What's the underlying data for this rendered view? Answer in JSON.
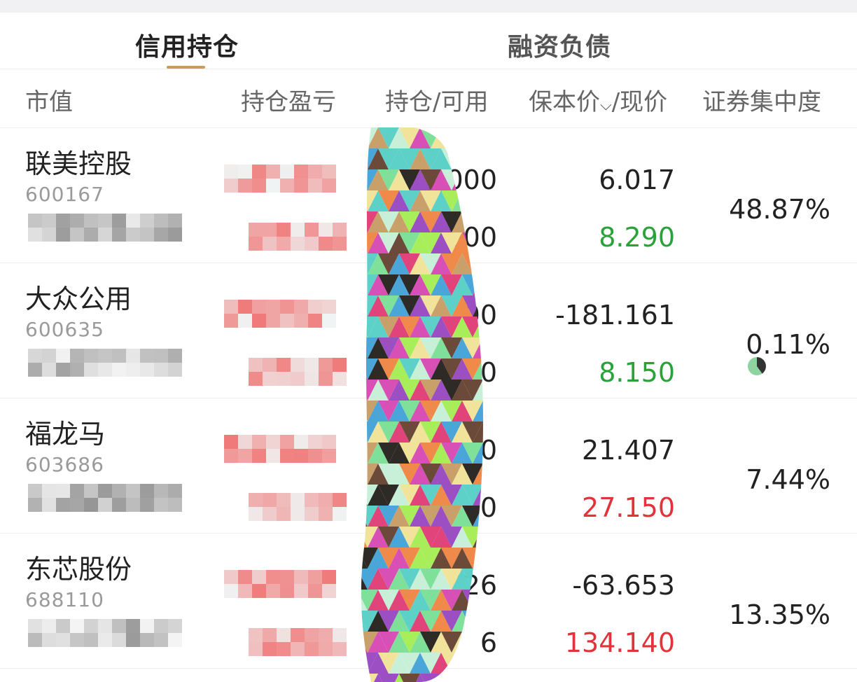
{
  "tabs": [
    {
      "label": "信用持仓",
      "active": true
    },
    {
      "label": "融资负债",
      "active": false
    }
  ],
  "columns": {
    "market_value": "市值",
    "profit_loss": "持仓盈亏",
    "position": "持仓/可用",
    "cost_price": "保本价",
    "current_price": "/现价",
    "concentration": "证券集中度"
  },
  "rows": [
    {
      "name": "联美控股",
      "code": "600167",
      "position": "43,000",
      "available": ",000",
      "cost": "6.017",
      "price": "8.290",
      "price_color": "green",
      "concentration": "48.87%"
    },
    {
      "name": "大众公用",
      "code": "600635",
      "position": "00",
      "available": "0",
      "cost": "-181.161",
      "price": "8.150",
      "price_color": "green",
      "concentration": "0.11%"
    },
    {
      "name": "福龙马",
      "code": "603686",
      "position": "0",
      "available": "0",
      "cost": "21.407",
      "price": "27.150",
      "price_color": "red",
      "concentration": "7.44%"
    },
    {
      "name": "东芯股份",
      "code": "688110",
      "position": "726",
      "available": "6",
      "cost": "-63.653",
      "price": "134.140",
      "price_color": "red",
      "concentration": "13.35%"
    }
  ],
  "colors": {
    "accent": "#c99a5d",
    "up": "#e2323a",
    "down": "#29a23a"
  },
  "icons": {
    "sort": "chevron-down-icon"
  }
}
